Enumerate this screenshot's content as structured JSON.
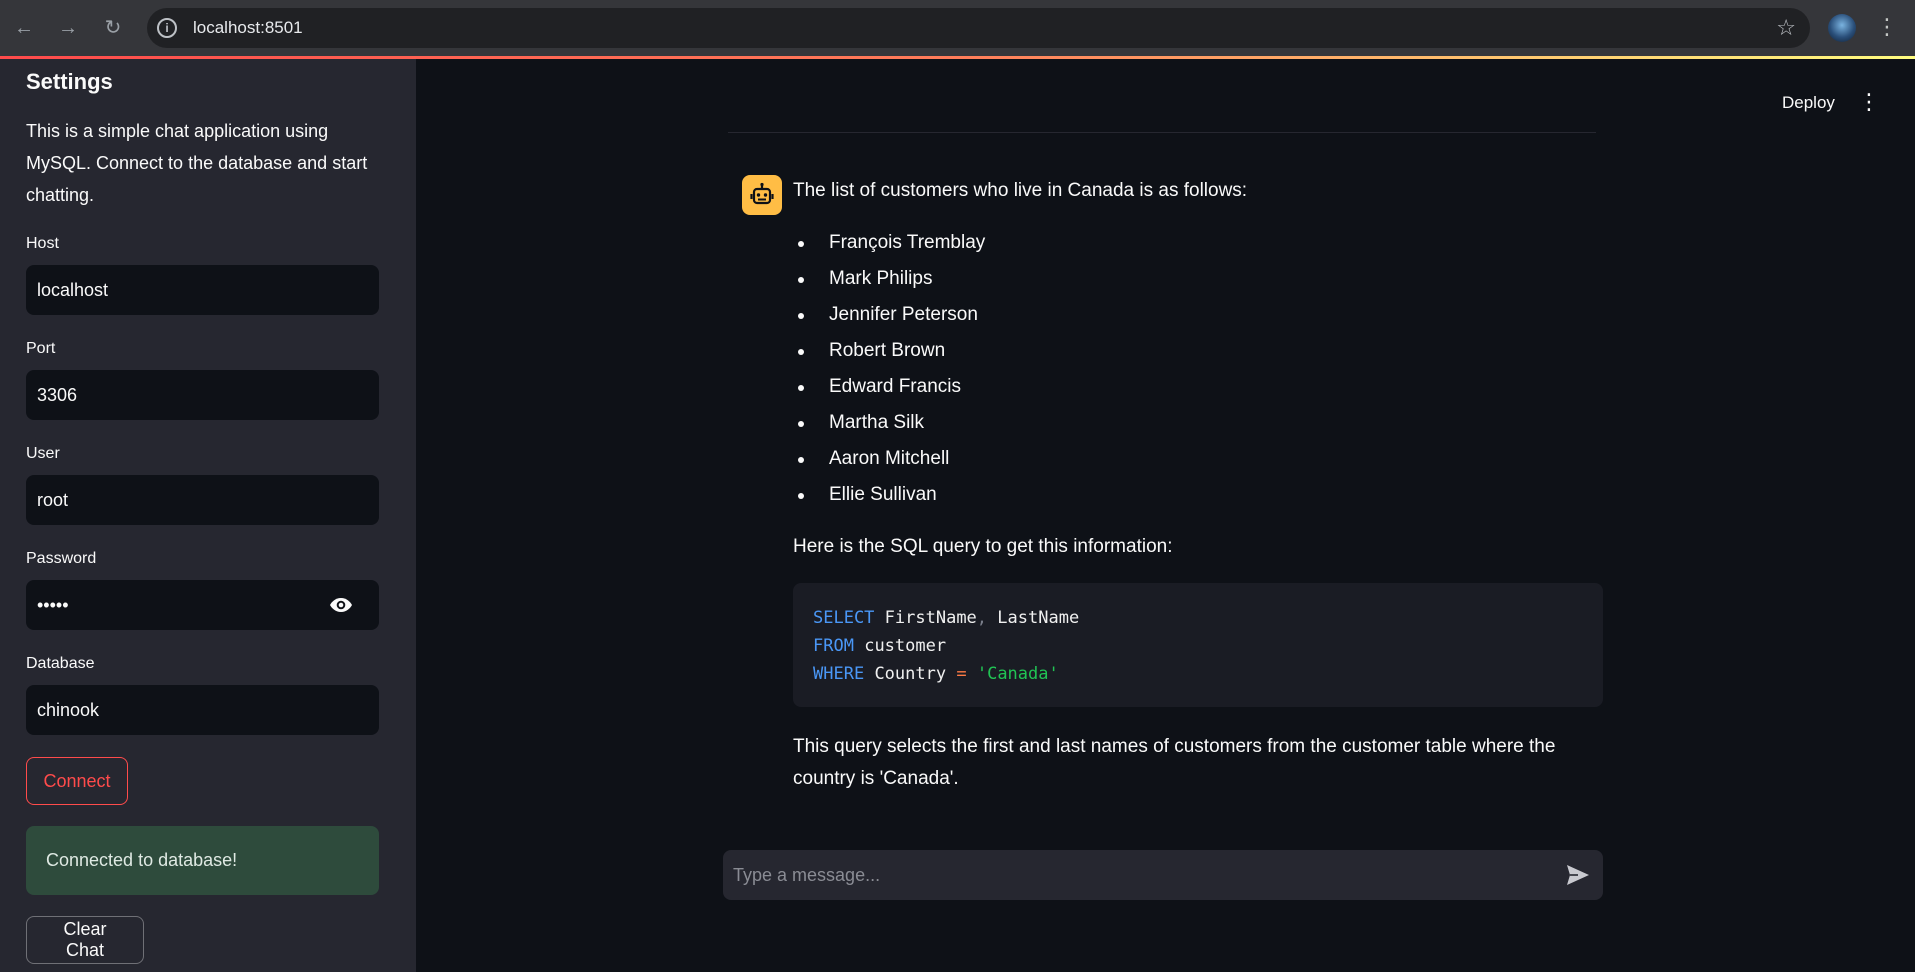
{
  "browser": {
    "url": "localhost:8501",
    "back_icon": "arrow-left-icon",
    "forward_icon": "arrow-right-icon",
    "reload_icon": "reload-icon"
  },
  "sidebar": {
    "title": "Settings",
    "description": "This is a simple chat application using MySQL. Connect to the database and start chatting.",
    "host_label": "Host",
    "host_value": "localhost",
    "port_label": "Port",
    "port_value": "3306",
    "user_label": "User",
    "user_value": "root",
    "password_label": "Password",
    "password_value": "admin",
    "database_label": "Database",
    "database_value": "chinook",
    "connect_label": "Connect",
    "success_message": "Connected to database!",
    "clear_label": "Clear Chat"
  },
  "header": {
    "deploy_label": "Deploy"
  },
  "chat": {
    "intro": "The list of customers who live in Canada is as follows:",
    "customers": [
      "François Tremblay",
      "Mark Philips",
      "Jennifer Peterson",
      "Robert Brown",
      "Edward Francis",
      "Martha Silk",
      "Aaron Mitchell",
      "Ellie Sullivan"
    ],
    "query_intro": "Here is the SQL query to get this information:",
    "code": {
      "line1_kw": "SELECT",
      "line1_a": "FirstName",
      "line1_comma": ",",
      "line1_b": "LastName",
      "line2_kw": "FROM",
      "line2_a": "customer",
      "line3_kw": "WHERE",
      "line3_a": "Country",
      "line3_op": "=",
      "line3_str": "'Canada'"
    },
    "explanation": "This query selects the first and last names of customers from the customer table where the country is 'Canada'.",
    "input_placeholder": "Type a message..."
  },
  "colors": {
    "primary": "#ff4b4b",
    "assistant_avatar": "#ffbd45",
    "success_bg": "#2e4b3c"
  }
}
